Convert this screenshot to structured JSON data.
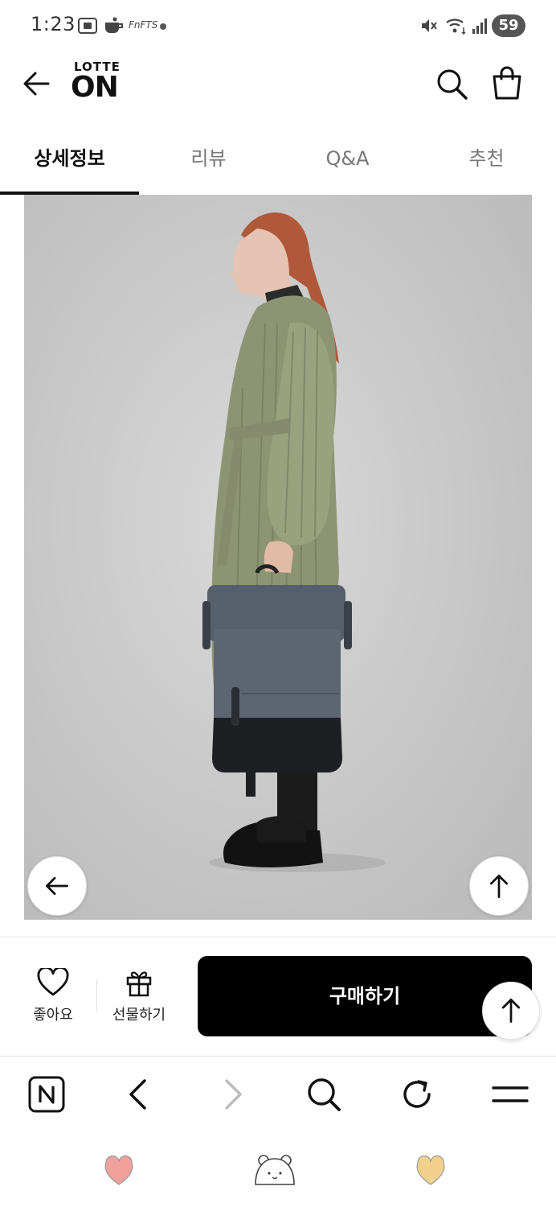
{
  "status_bar": {
    "time": "1:23",
    "notification_text": "FnFTS",
    "battery": "59"
  },
  "header": {
    "logo_top": "LOTTE",
    "logo_bottom": "ON",
    "icons": [
      "back-arrow-icon",
      "search-icon",
      "shopping-bag-icon"
    ]
  },
  "tabs": [
    {
      "label": "상세정보",
      "active": true
    },
    {
      "label": "리뷰",
      "active": false
    },
    {
      "label": "Q&A",
      "active": false
    },
    {
      "label": "추천",
      "active": false
    }
  ],
  "actions": {
    "like_label": "좋아요",
    "gift_label": "선물하기",
    "buy_label": "구매하기"
  },
  "browser_nav": [
    "naver-icon",
    "back-icon",
    "forward-icon",
    "search-icon",
    "refresh-icon",
    "menu-icon"
  ],
  "system_nav": [
    "pink-heart-icon",
    "bear-face-icon",
    "yellow-heart-icon"
  ],
  "colors": {
    "accent": "#000000",
    "tab_active": "#111111",
    "tab_inactive": "#777777",
    "heart_pink": "#f0a19b",
    "heart_yellow": "#f2d28a"
  }
}
